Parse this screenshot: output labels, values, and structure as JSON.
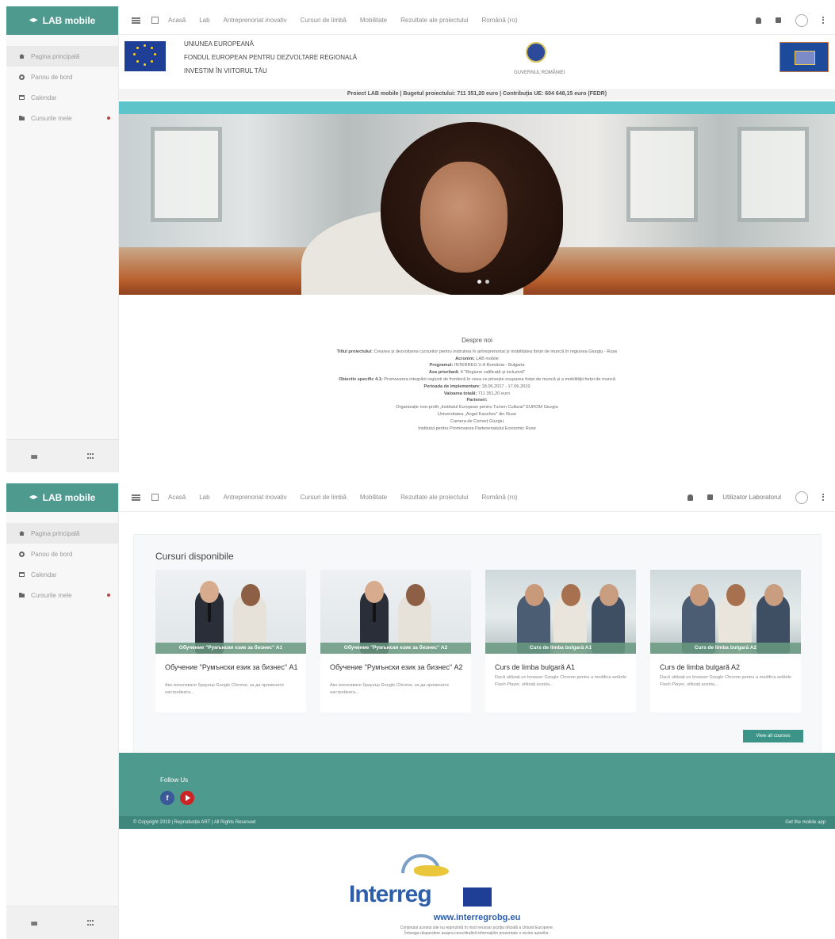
{
  "app": {
    "brand": "LAB mobile",
    "nav": [
      {
        "label": "Pagina principală",
        "icon": "home-icon"
      },
      {
        "label": "Panou de bord",
        "icon": "dashboard-icon"
      },
      {
        "label": "Calendar",
        "icon": "calendar-icon"
      },
      {
        "label": "Cursurile mele",
        "icon": "folder-icon"
      }
    ],
    "top_links": [
      "Acasă",
      "Lab",
      "Antreprenoriat inovativ",
      "Cursuri de limbă",
      "Mobilitate",
      "Rezultate ale proiectului",
      "Română (ro)"
    ],
    "user_name": "Utilizator Laboratorul"
  },
  "banner": {
    "eu_lines": [
      "UNIUNEA EUROPEANĂ",
      "FONDUL EUROPEAN PENTRU DEZVOLTARE REGIONALĂ",
      "INVESTIM ÎN VIITORUL TĂU"
    ],
    "gov_caption": "GUVERNUL ROMÂNIEI",
    "budget": "Proiect LAB mobile | Bugetul proiectului: 711 351,20 euro | Contribuţia UE: 604 648,15 euro (FEDR)"
  },
  "about": {
    "title": "Despre noi",
    "lines": [
      {
        "label": "Titlul proiectului:",
        "text": "Crearea și dezvoltarea cursurilor pentru instruirea în antreprenoriat și mobilitatea forței de muncă în regiunea Giurgiu - Ruse"
      },
      {
        "label": "Acronim:",
        "text": "LAB mobile"
      },
      {
        "label": "Programul:",
        "text": "INTERREG V-A România - Bulgaria"
      },
      {
        "label": "Axa prioritară:",
        "text": "4 \"Regiune calificată și incluzivă\""
      },
      {
        "label": "Obiectiv specific 4.1:",
        "text": "Promovarea integrării regiunii de frontieră în ceea ce privește ocuparea forței de muncă și a mobilității forței de muncă"
      },
      {
        "label": "Perioada de implementare:",
        "text": "18.06.2017 - 17.06.2019"
      },
      {
        "label": "Valoarea totală:",
        "text": "711 351,20 euro"
      },
      {
        "label": "Parteneri:",
        "text": ""
      },
      {
        "label": "",
        "text": "Organizație non-profit „Institutul European pentru Turism Cultural\" EUROM Giurgiu"
      },
      {
        "label": "",
        "text": "Universitatea „Angel Kanchev\" din Ruse"
      },
      {
        "label": "",
        "text": "Camera de Comerț Giurgiu"
      },
      {
        "label": "",
        "text": "Institutul pentru Promovarea Parteneriatului Economic Ruse"
      }
    ]
  },
  "courses": {
    "heading": "Cursuri disponibile",
    "items": [
      {
        "caption": "Обучение \"Румънски език за бизнес\" A1",
        "title": "Обучение \"Румънски език за бизнес\" A1",
        "desc": "Ако използвате браузър Google Chrome, за да промените настройката..."
      },
      {
        "caption": "Обучение \"Румънски език за бизнес\" A2",
        "title": "Обучение \"Румънски език за бизнес\" A2",
        "desc": "Ако използвате браузър Google Chrome, за да промените настройката..."
      },
      {
        "caption": "Curs de limba bulgară A1",
        "title": "Curs de limba bulgară A1",
        "desc": "Dacă utilizați un browser Google Chrome pentru a modifica setările Flash Player, utilizați acesta..."
      },
      {
        "caption": "Curs de limba bulgară A2",
        "title": "Curs de limba bulgară A2",
        "desc": "Dacă utilizați un browser Google Chrome pentru a modifica setările Flash Player, utilizați acesta..."
      }
    ],
    "view_all": "View all courses"
  },
  "footer": {
    "follow": "Follow Us",
    "copyright": "© Copyright 2019  |  Reproducție ART  |  All Rights Reserved",
    "app": "Get the mobile app"
  },
  "interreg": {
    "logo": "Interreg",
    "url": "www.interregrobg.eu",
    "disclaimer": [
      "Conținutul acestui site nu reprezintă în mod necesar poziția oficială a Uniunii Europene.",
      "Întreaga răspundere asupra corectitudinii informațiilor prezentate o revine autorilor."
    ]
  }
}
